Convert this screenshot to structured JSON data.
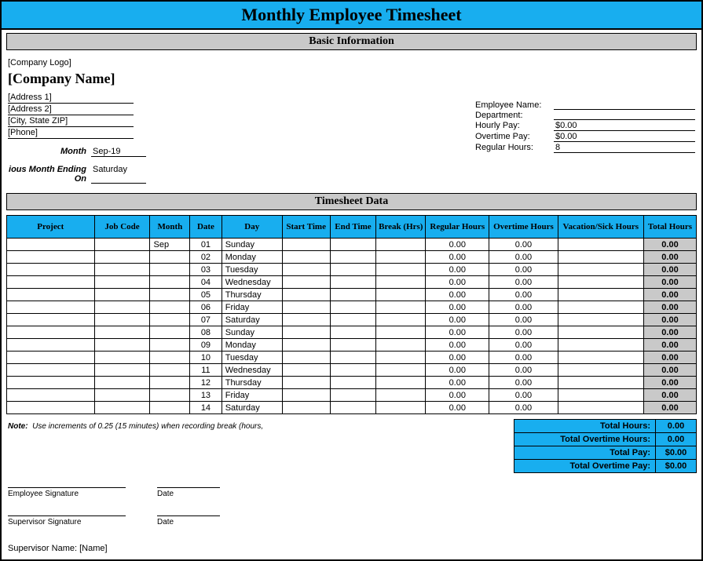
{
  "title": "Monthly Employee Timesheet",
  "section_basic": "Basic Information",
  "section_tsdata": "Timesheet Data",
  "company": {
    "logo_placeholder": "[Company Logo]",
    "name_placeholder": "[Company Name]",
    "address1": "[Address 1]",
    "address2": "[Address 2]",
    "city_state_zip": "[City, State ZIP]",
    "phone": "[Phone]"
  },
  "period": {
    "month_label": "Month",
    "month_value": "Sep-19",
    "ending_label": "ious Month Ending On",
    "ending_value": "Saturday"
  },
  "employee": {
    "name_label": "Employee Name:",
    "name_value": "",
    "dept_label": "Department:",
    "dept_value": "",
    "hourly_label": "Hourly Pay:",
    "hourly_value": "$0.00",
    "ot_label": "Overtime Pay:",
    "ot_value": "$0.00",
    "reghours_label": "Regular Hours:",
    "reghours_value": "8"
  },
  "headers": {
    "project": "Project",
    "jobcode": "Job Code",
    "month": "Month",
    "date": "Date",
    "day": "Day",
    "start": "Start Time",
    "end": "End Time",
    "break": "Break (Hrs)",
    "regular": "Regular Hours",
    "overtime": "Overtime Hours",
    "vacation": "Vacation/Sick Hours",
    "total": "Total Hours"
  },
  "chart_data": {
    "type": "table",
    "columns": [
      "Project",
      "Job Code",
      "Month",
      "Date",
      "Day",
      "Start Time",
      "End Time",
      "Break (Hrs)",
      "Regular Hours",
      "Overtime Hours",
      "Vacation/Sick Hours",
      "Total Hours"
    ],
    "rows": [
      {
        "project": "",
        "jobcode": "",
        "month": "Sep",
        "date": "01",
        "day": "Sunday",
        "start": "",
        "end": "",
        "break": "",
        "regular": "0.00",
        "overtime": "0.00",
        "vacation": "",
        "total": "0.00"
      },
      {
        "project": "",
        "jobcode": "",
        "month": "",
        "date": "02",
        "day": "Monday",
        "start": "",
        "end": "",
        "break": "",
        "regular": "0.00",
        "overtime": "0.00",
        "vacation": "",
        "total": "0.00"
      },
      {
        "project": "",
        "jobcode": "",
        "month": "",
        "date": "03",
        "day": "Tuesday",
        "start": "",
        "end": "",
        "break": "",
        "regular": "0.00",
        "overtime": "0.00",
        "vacation": "",
        "total": "0.00"
      },
      {
        "project": "",
        "jobcode": "",
        "month": "",
        "date": "04",
        "day": "Wednesday",
        "start": "",
        "end": "",
        "break": "",
        "regular": "0.00",
        "overtime": "0.00",
        "vacation": "",
        "total": "0.00"
      },
      {
        "project": "",
        "jobcode": "",
        "month": "",
        "date": "05",
        "day": "Thursday",
        "start": "",
        "end": "",
        "break": "",
        "regular": "0.00",
        "overtime": "0.00",
        "vacation": "",
        "total": "0.00"
      },
      {
        "project": "",
        "jobcode": "",
        "month": "",
        "date": "06",
        "day": "Friday",
        "start": "",
        "end": "",
        "break": "",
        "regular": "0.00",
        "overtime": "0.00",
        "vacation": "",
        "total": "0.00"
      },
      {
        "project": "",
        "jobcode": "",
        "month": "",
        "date": "07",
        "day": "Saturday",
        "start": "",
        "end": "",
        "break": "",
        "regular": "0.00",
        "overtime": "0.00",
        "vacation": "",
        "total": "0.00"
      },
      {
        "project": "",
        "jobcode": "",
        "month": "",
        "date": "08",
        "day": "Sunday",
        "start": "",
        "end": "",
        "break": "",
        "regular": "0.00",
        "overtime": "0.00",
        "vacation": "",
        "total": "0.00"
      },
      {
        "project": "",
        "jobcode": "",
        "month": "",
        "date": "09",
        "day": "Monday",
        "start": "",
        "end": "",
        "break": "",
        "regular": "0.00",
        "overtime": "0.00",
        "vacation": "",
        "total": "0.00"
      },
      {
        "project": "",
        "jobcode": "",
        "month": "",
        "date": "10",
        "day": "Tuesday",
        "start": "",
        "end": "",
        "break": "",
        "regular": "0.00",
        "overtime": "0.00",
        "vacation": "",
        "total": "0.00"
      },
      {
        "project": "",
        "jobcode": "",
        "month": "",
        "date": "11",
        "day": "Wednesday",
        "start": "",
        "end": "",
        "break": "",
        "regular": "0.00",
        "overtime": "0.00",
        "vacation": "",
        "total": "0.00"
      },
      {
        "project": "",
        "jobcode": "",
        "month": "",
        "date": "12",
        "day": "Thursday",
        "start": "",
        "end": "",
        "break": "",
        "regular": "0.00",
        "overtime": "0.00",
        "vacation": "",
        "total": "0.00"
      },
      {
        "project": "",
        "jobcode": "",
        "month": "",
        "date": "13",
        "day": "Friday",
        "start": "",
        "end": "",
        "break": "",
        "regular": "0.00",
        "overtime": "0.00",
        "vacation": "",
        "total": "0.00"
      },
      {
        "project": "",
        "jobcode": "",
        "month": "",
        "date": "14",
        "day": "Saturday",
        "start": "",
        "end": "",
        "break": "",
        "regular": "0.00",
        "overtime": "0.00",
        "vacation": "",
        "total": "0.00"
      }
    ]
  },
  "note": {
    "label": "Note:",
    "text": "Use increments of 0.25 (15 minutes) when recording break (hours,"
  },
  "summary": {
    "total_hours_label": "Total Hours:",
    "total_hours_value": "0.00",
    "total_ot_hours_label": "Total Overtime Hours:",
    "total_ot_hours_value": "0.00",
    "total_pay_label": "Total Pay:",
    "total_pay_value": "$0.00",
    "total_ot_pay_label": "Total Overtime Pay:",
    "total_ot_pay_value": "$0.00"
  },
  "signatures": {
    "emp_sig_label": "Employee Signature",
    "date_label": "Date",
    "sup_sig_label": "Supervisor Signature",
    "sup_name_label": "Supervisor Name: [Name]"
  }
}
